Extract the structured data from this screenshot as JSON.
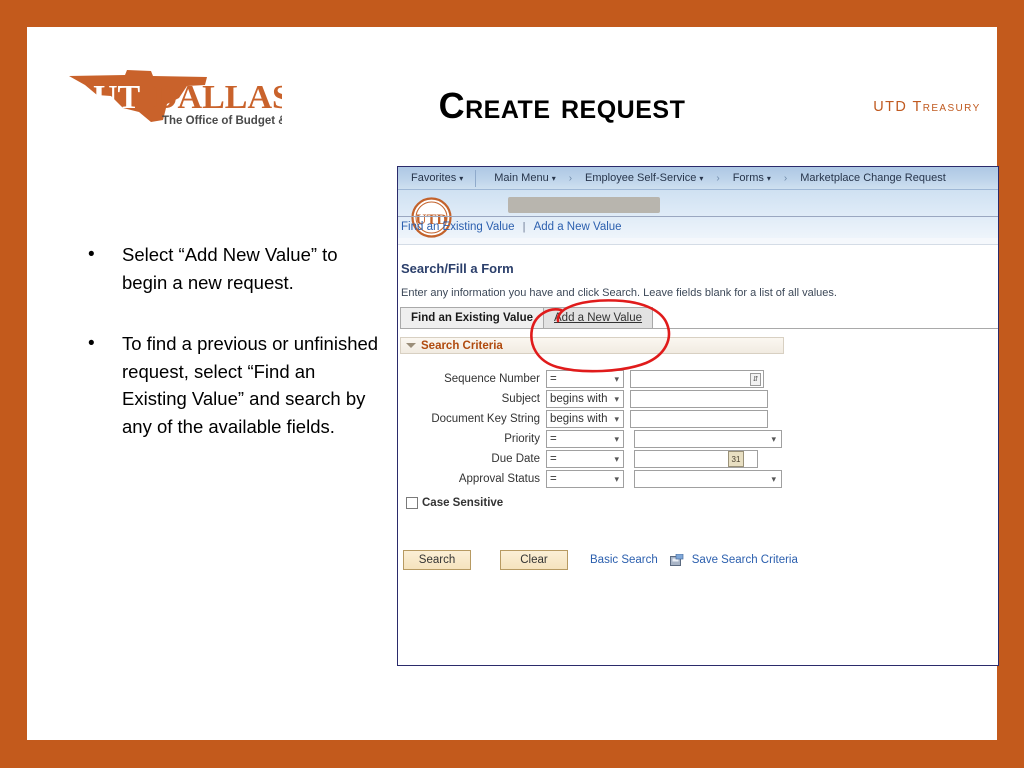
{
  "slide": {
    "border_color": "#C35A1C",
    "background": "#FFFFFF",
    "title": "Create request",
    "treasury_label": "UTD Treasury"
  },
  "logo": {
    "wordmark_ut": "UT",
    "wordmark_dallas": "DALLAS",
    "tagline": "The Office of Budget & Finance",
    "color": "#C9622B"
  },
  "bullets": [
    {
      "marker": "•",
      "text": "Select “Add New Value” to begin a new request."
    },
    {
      "marker": "•",
      "text": "To find a previous or unfinished request, select “Find an Existing Value” and search by any of the available fields."
    }
  ],
  "screenshot": {
    "nav": {
      "favorites": "Favorites",
      "main_menu": "Main Menu",
      "crumbs": [
        "Employee Self-Service",
        "Forms",
        "Marketplace Change Request"
      ],
      "caret": "▾",
      "chevron": "›"
    },
    "header": {
      "logo_text": "UTD",
      "logo_color": "#C3622B",
      "redacted": ""
    },
    "heading": "Search/Fill a Form",
    "instruction": "Enter any information you have and click Search. Leave fields blank for a list of all values.",
    "tabs": [
      {
        "label": "Find an Existing Value",
        "active": true
      },
      {
        "label": "Add a New Value",
        "active": false
      }
    ],
    "criteria_section": {
      "label": "Search Criteria",
      "collapse_icon": "▼"
    },
    "fields": [
      {
        "label": "Sequence Number",
        "operator": "=",
        "value": "",
        "control": "lookup"
      },
      {
        "label": "Subject",
        "operator": "begins with",
        "value": "",
        "control": "text"
      },
      {
        "label": "Document Key String",
        "operator": "begins with",
        "value": "",
        "control": "text"
      },
      {
        "label": "Priority",
        "operator": "=",
        "value": "",
        "control": "select"
      },
      {
        "label": "Due Date",
        "operator": "=",
        "value": "",
        "control": "date"
      },
      {
        "label": "Approval Status",
        "operator": "=",
        "value": "",
        "control": "select"
      }
    ],
    "case_sensitive": {
      "label": "Case Sensitive",
      "checked": false
    },
    "buttons": {
      "search": "Search",
      "clear": "Clear",
      "basic_search": "Basic Search",
      "save_search_criteria": "Save Search Criteria"
    },
    "footer": {
      "find_existing": "Find an Existing Value",
      "separator": "|",
      "add_new": "Add a New Value"
    }
  },
  "annotation": {
    "type": "hand-drawn-circle",
    "color": "#E01B1B",
    "targets": "Add a New Value"
  }
}
